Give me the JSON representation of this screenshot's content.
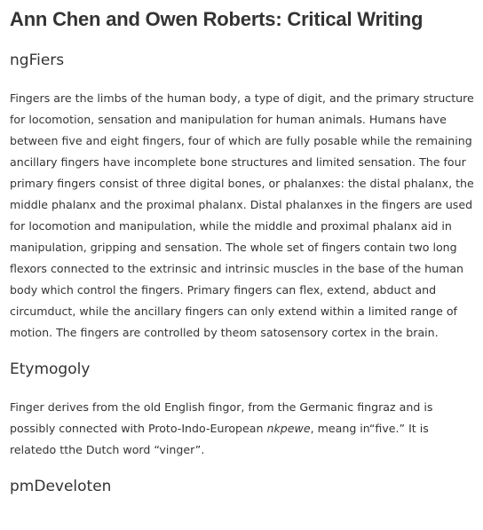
{
  "document": {
    "title": "Ann Chen and Owen Roberts: Critical Writing",
    "sections": [
      {
        "heading": "ngFiers",
        "paragraph": "Fingers are the limbs of the human body, a type of digit, and the primary structure for locomotion, sensation and manipulation for human animals. Humans have between five and eight fingers, four of which are fully posable while the remaining ancillary fingers have incomplete bone structures and limited sensation. The four primary fingers consist of three digital bones, or phalanxes: the distal phalanx, the middle phalanx and the proximal phalanx. Distal phalanxes in the fingers are used for locomotion and manipulation, while the middle and proximal phalanx aid in manipulation, gripping and sensation. The whole set of fingers contain two long flexors connected to the extrinsic and intrinsic muscles in the base of the human body which control the fingers. Primary fingers can flex, extend, abduct and circumduct, while the ancillary fingers can only extend within a limited range of motion. The fingers are controlled by theom satosensory cortex in the brain."
      },
      {
        "heading": "Etymogoly",
        "paragraph_before_italic": "Finger derives from the old English fingor, from the Germanic fingraz and is possibly connected with Proto-Indo-European ",
        "paragraph_italic": "nkpewe",
        "paragraph_after_italic": ", meang in“five.” It is relatedo tthe Dutch word “vinger”."
      },
      {
        "heading": "pmDeveloten"
      }
    ]
  }
}
